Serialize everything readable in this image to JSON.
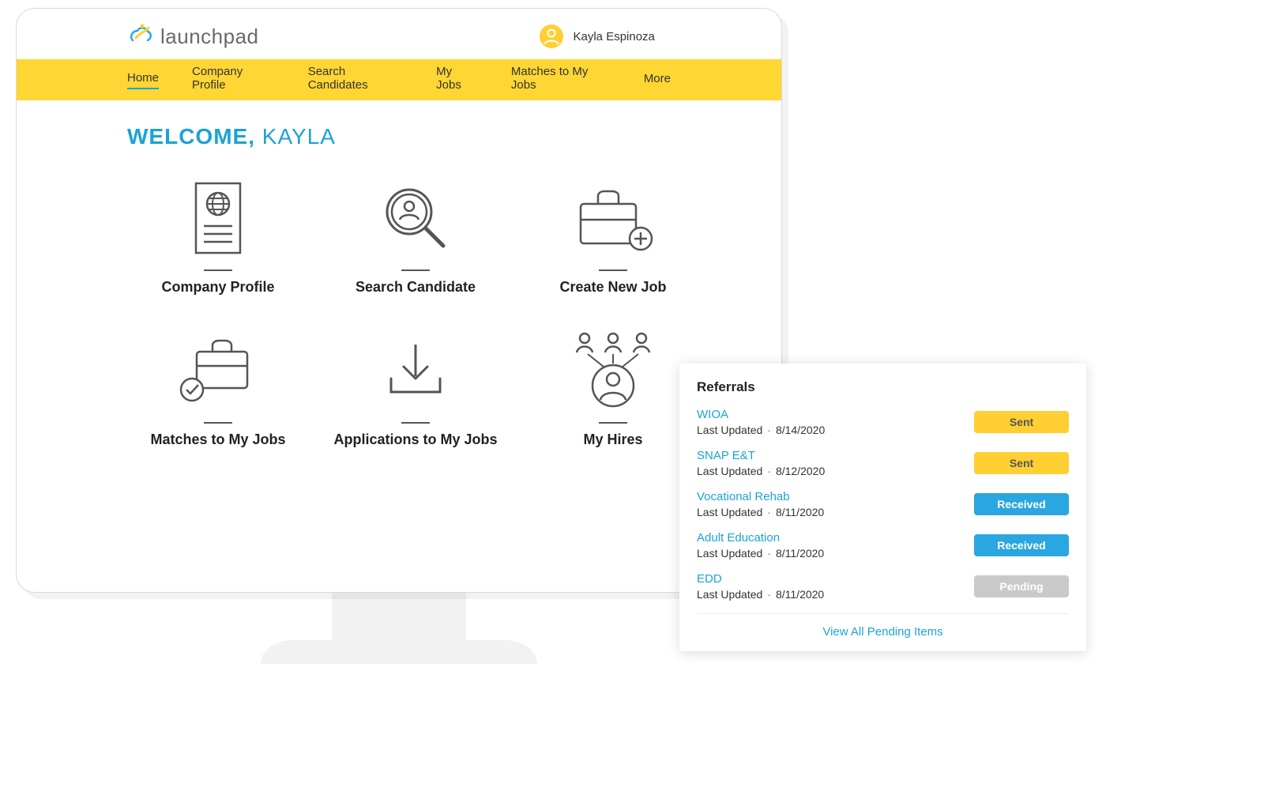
{
  "brand": {
    "name": "launchpad"
  },
  "user": {
    "name": "Kayla Espinoza",
    "first_name": "KAYLA"
  },
  "nav": {
    "items": [
      {
        "label": "Home",
        "active": true
      },
      {
        "label": "Company Profile",
        "active": false
      },
      {
        "label": "Search Candidates",
        "active": false
      },
      {
        "label": "My Jobs",
        "active": false
      },
      {
        "label": "Matches to My Jobs",
        "active": false
      },
      {
        "label": "More",
        "active": false
      }
    ]
  },
  "welcome": {
    "prefix": "WELCOME, "
  },
  "tiles": [
    {
      "id": "company-profile",
      "label": "Company Profile",
      "icon": "document-globe-icon"
    },
    {
      "id": "search-candidate",
      "label": "Search Candidate",
      "icon": "person-magnifier-icon"
    },
    {
      "id": "create-new-job",
      "label": "Create New Job",
      "icon": "briefcase-plus-icon"
    },
    {
      "id": "matches-my-jobs",
      "label": "Matches to My Jobs",
      "icon": "briefcase-check-icon"
    },
    {
      "id": "applications-my-jobs",
      "label": "Applications to My Jobs",
      "icon": "download-tray-icon"
    },
    {
      "id": "my-hires",
      "label": "My Hires",
      "icon": "people-network-icon"
    }
  ],
  "referrals": {
    "title": "Referrals",
    "updated_label": "Last Updated",
    "items": [
      {
        "name": "WIOA",
        "date": "8/14/2020",
        "status": "Sent",
        "status_class": "sent"
      },
      {
        "name": "SNAP E&T",
        "date": "8/12/2020",
        "status": "Sent",
        "status_class": "sent"
      },
      {
        "name": "Vocational Rehab",
        "date": "8/11/2020",
        "status": "Received",
        "status_class": "received"
      },
      {
        "name": "Adult Education",
        "date": "8/11/2020",
        "status": "Received",
        "status_class": "received"
      },
      {
        "name": "EDD",
        "date": "8/11/2020",
        "status": "Pending",
        "status_class": "pending"
      }
    ],
    "view_all": "View All Pending Items"
  },
  "colors": {
    "accent_yellow": "#ffd633",
    "accent_blue": "#1ca3d6",
    "badge_received": "#2aa6e0",
    "badge_pending": "#c9c9c9"
  }
}
